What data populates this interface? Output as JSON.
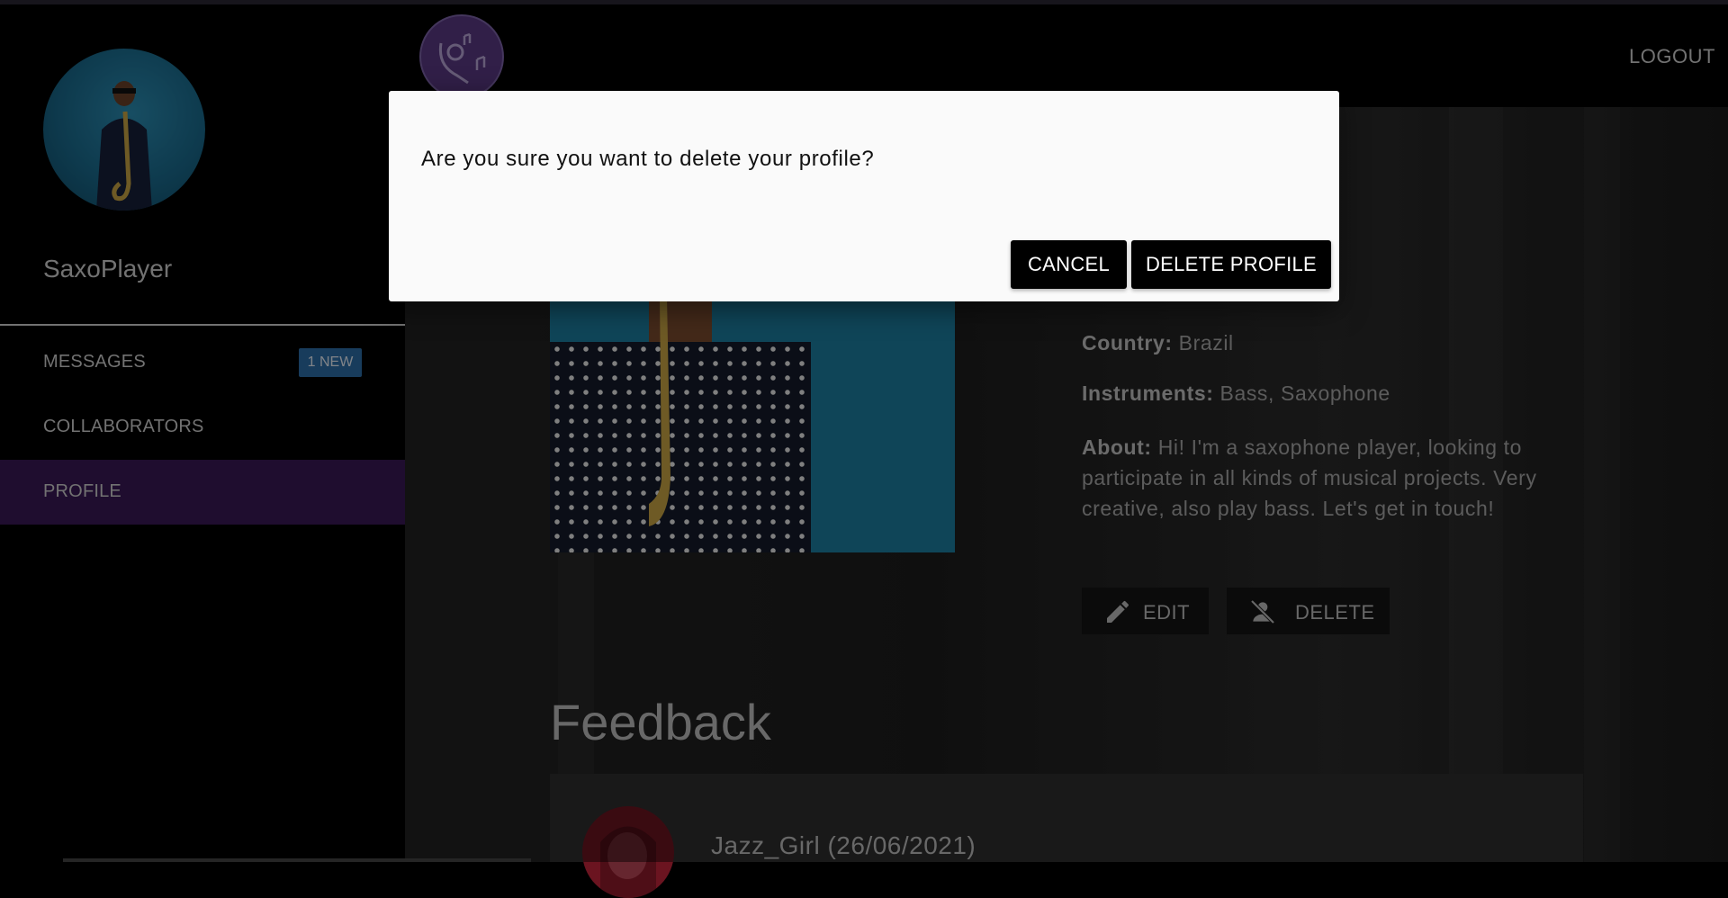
{
  "sidebar": {
    "username": "SaxoPlayer",
    "items": [
      {
        "label": "MESSAGES",
        "badge": "1 NEW"
      },
      {
        "label": "COLLABORATORS"
      },
      {
        "label": "PROFILE"
      }
    ]
  },
  "header": {
    "logout_label": "LOGOUT"
  },
  "profile": {
    "country_label": "Country:",
    "country_value": "Brazil",
    "instruments_label": "Instruments:",
    "instruments_value": "Bass, Saxophone",
    "about_label": "About:",
    "about_value": "Hi! I'm a saxophone player, looking to participate in all kinds of musical projects. Very creative, also play bass. Let's get in touch!",
    "edit_label": "EDIT",
    "delete_label": "DELETE"
  },
  "feedback": {
    "title": "Feedback",
    "entries": [
      {
        "author": "Jazz_Girl (26/06/2021)"
      }
    ]
  },
  "dialog": {
    "message": "Are you sure you want to delete your profile?",
    "cancel_label": "CANCEL",
    "confirm_label": "DELETE PROFILE"
  },
  "colors": {
    "accent": "#3a1957",
    "badge": "#2c6ea8",
    "dialog_bg": "#fafafa"
  },
  "icons": [
    "logo-icon",
    "pencil-icon",
    "person-off-icon"
  ]
}
